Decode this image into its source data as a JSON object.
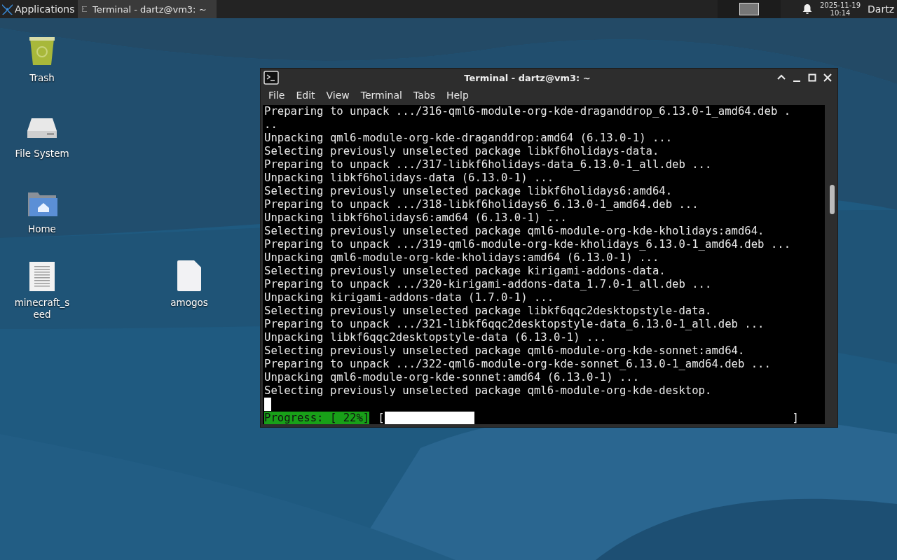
{
  "panel": {
    "menu_label": "Applications",
    "tasks": [
      {
        "label": "Terminal - dartz@vm3: ~",
        "selected": true
      }
    ],
    "date": "2025-11-19",
    "time": "10:14",
    "user": "Dartz"
  },
  "desktop_icons": [
    {
      "label": "Trash",
      "kind": "trash"
    },
    {
      "label": "File System",
      "kind": "drive"
    },
    {
      "label": "Home",
      "kind": "home"
    },
    {
      "label": "minecraft_seed",
      "kind": "text-file"
    },
    {
      "label": "amogos",
      "kind": "file"
    }
  ],
  "terminal": {
    "title": "Terminal - dartz@vm3: ~",
    "menu": [
      "File",
      "Edit",
      "View",
      "Terminal",
      "Tabs",
      "Help"
    ],
    "lines": [
      "Preparing to unpack .../316-qml6-module-org-kde-draganddrop_6.13.0-1_amd64.deb .",
      "..",
      "Unpacking qml6-module-org-kde-draganddrop:amd64 (6.13.0-1) ...",
      "Selecting previously unselected package libkf6holidays-data.",
      "Preparing to unpack .../317-libkf6holidays-data_6.13.0-1_all.deb ...",
      "Unpacking libkf6holidays-data (6.13.0-1) ...",
      "Selecting previously unselected package libkf6holidays6:amd64.",
      "Preparing to unpack .../318-libkf6holidays6_6.13.0-1_amd64.deb ...",
      "Unpacking libkf6holidays6:amd64 (6.13.0-1) ...",
      "Selecting previously unselected package qml6-module-org-kde-kholidays:amd64.",
      "Preparing to unpack .../319-qml6-module-org-kde-kholidays_6.13.0-1_amd64.deb ...",
      "Unpacking qml6-module-org-kde-kholidays:amd64 (6.13.0-1) ...",
      "Selecting previously unselected package kirigami-addons-data.",
      "Preparing to unpack .../320-kirigami-addons-data_1.7.0-1_all.deb ...",
      "Unpacking kirigami-addons-data (1.7.0-1) ...",
      "Selecting previously unselected package libkf6qqc2desktopstyle-data.",
      "Preparing to unpack .../321-libkf6qqc2desktopstyle-data_6.13.0-1_all.deb ...",
      "Unpacking libkf6qqc2desktopstyle-data (6.13.0-1) ...",
      "Selecting previously unselected package qml6-module-org-kde-sonnet:amd64.",
      "Preparing to unpack .../322-qml6-module-org-kde-sonnet_6.13.0-1_amd64.deb ...",
      "Unpacking qml6-module-org-kde-sonnet:amd64 (6.13.0-1) ...",
      "Selecting previously unselected package qml6-module-org-kde-desktop."
    ],
    "progress": {
      "label": "Progress: [ 22%]",
      "open": "[",
      "close": "]",
      "level": 0.22
    }
  }
}
